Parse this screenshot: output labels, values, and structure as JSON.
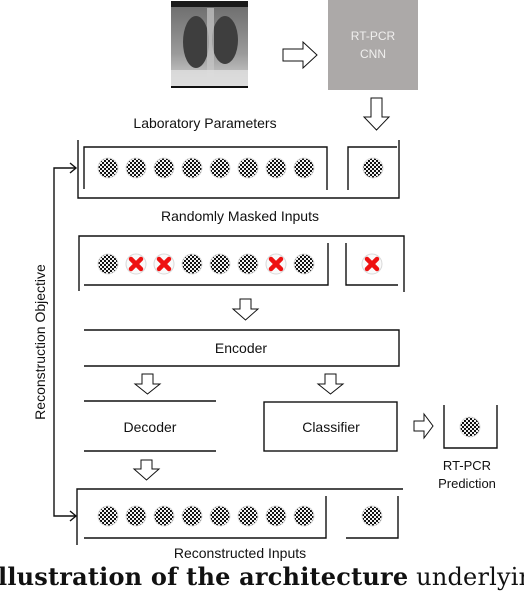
{
  "top": {
    "xray_image": "chest-xray",
    "cnn_box": {
      "line1": "RT-PCR",
      "line2": "CNN",
      "color": "#aca9a8"
    }
  },
  "rows": {
    "lab_parameters": {
      "label": "Laboratory Parameters",
      "inputs": [
        "filled",
        "filled",
        "filled",
        "filled",
        "filled",
        "filled",
        "filled",
        "filled"
      ],
      "extra": "filled"
    },
    "masked_inputs": {
      "label": "Randomly Masked Inputs",
      "inputs": [
        "filled",
        "masked",
        "masked",
        "filled",
        "filled",
        "filled",
        "masked",
        "filled"
      ],
      "extra": "masked"
    },
    "reconstructed_inputs": {
      "label": "Reconstructed Inputs",
      "inputs": [
        "filled",
        "filled",
        "filled",
        "filled",
        "filled",
        "filled",
        "filled",
        "filled"
      ],
      "extra": "filled"
    }
  },
  "blocks": {
    "encoder": "Encoder",
    "decoder": "Decoder",
    "classifier": "Classifier"
  },
  "prediction": {
    "line1": "RT-PCR",
    "line2": "Prediction"
  },
  "side_label": "Reconstruction Objective",
  "caption": {
    "bold": "llustration of the architecture",
    "rest": " underlyin"
  },
  "colors": {
    "mask_x": "#ee1111",
    "node_fill": "#111111"
  }
}
